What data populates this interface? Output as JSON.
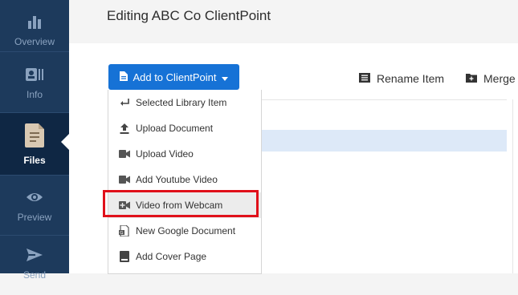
{
  "sidebar": {
    "items": [
      {
        "label": "Overview",
        "icon": "bar-chart-icon"
      },
      {
        "label": "Info",
        "icon": "id-card-icon"
      },
      {
        "label": "Files",
        "icon": "file-icon",
        "active": true
      },
      {
        "label": "Preview",
        "icon": "eye-icon"
      },
      {
        "label": "Send",
        "icon": "paper-plane-icon"
      }
    ]
  },
  "header": {
    "title": "Editing ABC Co ClientPoint"
  },
  "toolbar": {
    "add_label": "Add to ClientPoint",
    "rename_label": "Rename Item",
    "merge_label": "Merge"
  },
  "menu": {
    "items": [
      {
        "label": "Selected Library Item",
        "icon": "return-arrow-icon"
      },
      {
        "label": "Upload Document",
        "icon": "upload-icon"
      },
      {
        "label": "Upload Video",
        "icon": "video-camera-icon"
      },
      {
        "label": "Add Youtube Video",
        "icon": "video-camera-icon"
      },
      {
        "label": "Video from Webcam",
        "icon": "video-plus-icon"
      },
      {
        "label": "New Google Document",
        "icon": "google-doc-icon"
      },
      {
        "label": "Add Cover Page",
        "icon": "book-icon"
      }
    ]
  },
  "colors": {
    "sidebar_bg": "#1d3a5c",
    "sidebar_active": "#0f2744",
    "accent": "#1672d6",
    "callout": "#e0101a",
    "selection": "#dde9f8"
  }
}
